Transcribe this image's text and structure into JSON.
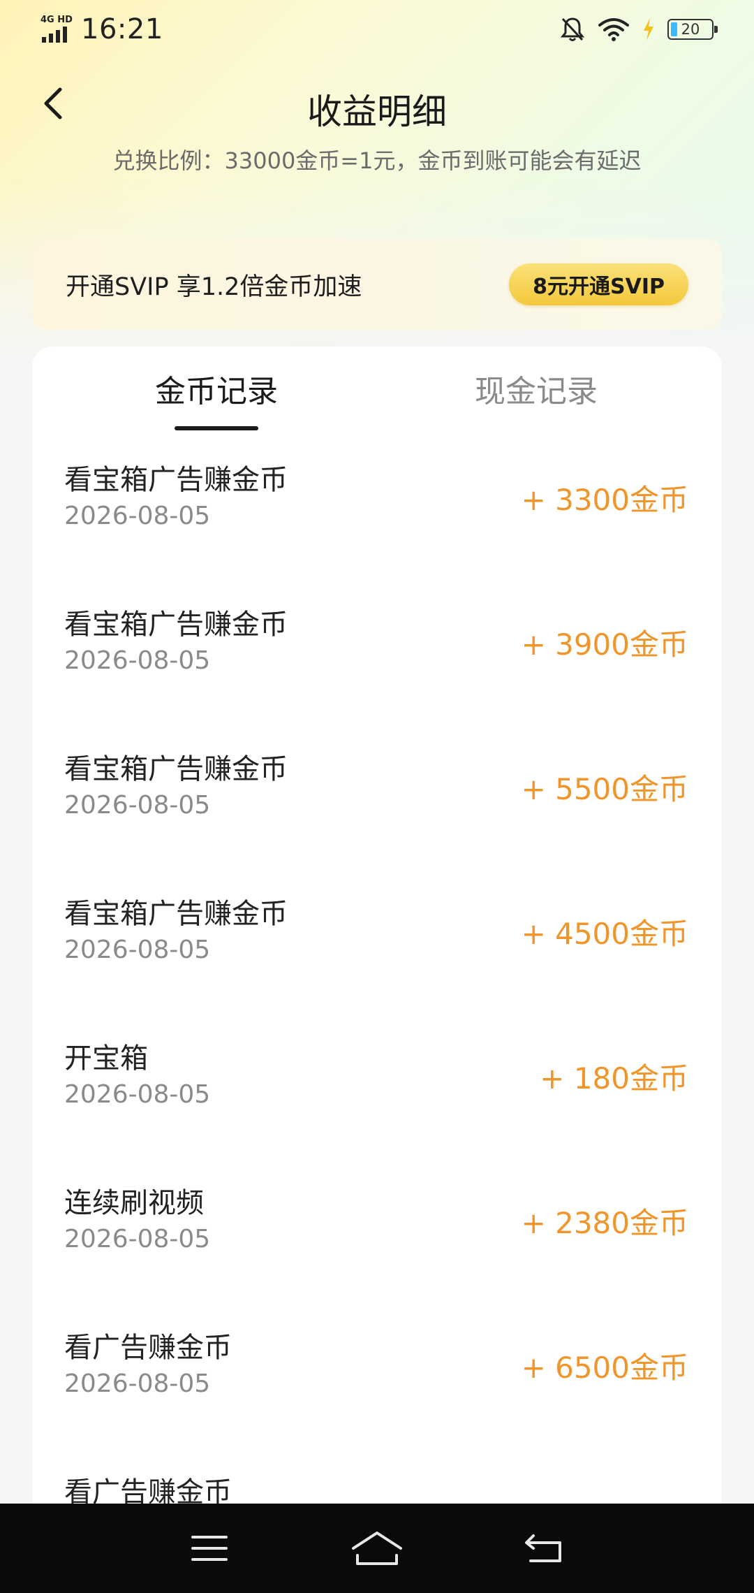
{
  "status_bar": {
    "network": "4G HD",
    "time": "16:21",
    "battery": "20"
  },
  "header": {
    "title": "收益明细",
    "subtitle": "兑换比例：33000金币=1元，金币到账可能会有延迟"
  },
  "svip": {
    "text": "开通SVIP 享1.2倍金币加速",
    "button_label": "8元开通SVIP"
  },
  "tabs": [
    {
      "label": "金币记录",
      "active": true
    },
    {
      "label": "现金记录",
      "active": false
    }
  ],
  "records": [
    {
      "title": "看宝箱广告赚金币",
      "date": "2026-08-05",
      "amount": "+ 3300金币"
    },
    {
      "title": "看宝箱广告赚金币",
      "date": "2026-08-05",
      "amount": "+ 3900金币"
    },
    {
      "title": "看宝箱广告赚金币",
      "date": "2026-08-05",
      "amount": "+ 5500金币"
    },
    {
      "title": "看宝箱广告赚金币",
      "date": "2026-08-05",
      "amount": "+ 4500金币"
    },
    {
      "title": "开宝箱",
      "date": "2026-08-05",
      "amount": "+ 180金币"
    },
    {
      "title": "连续刷视频",
      "date": "2026-08-05",
      "amount": "+ 2380金币"
    },
    {
      "title": "看广告赚金币",
      "date": "2026-08-05",
      "amount": "+ 6500金币"
    },
    {
      "title": "看广告赚金币",
      "date": "",
      "amount": ""
    }
  ],
  "colors": {
    "amount": "#f0952a",
    "svip_button": "#f3c83b",
    "nav_bar": "#0a0a0a"
  },
  "icons": {
    "back": "chevron-left-icon",
    "menu": "menu-icon",
    "home": "home-icon",
    "return": "return-icon",
    "mute": "bell-off-icon",
    "wifi": "wifi-icon",
    "charging": "lightning-icon"
  }
}
